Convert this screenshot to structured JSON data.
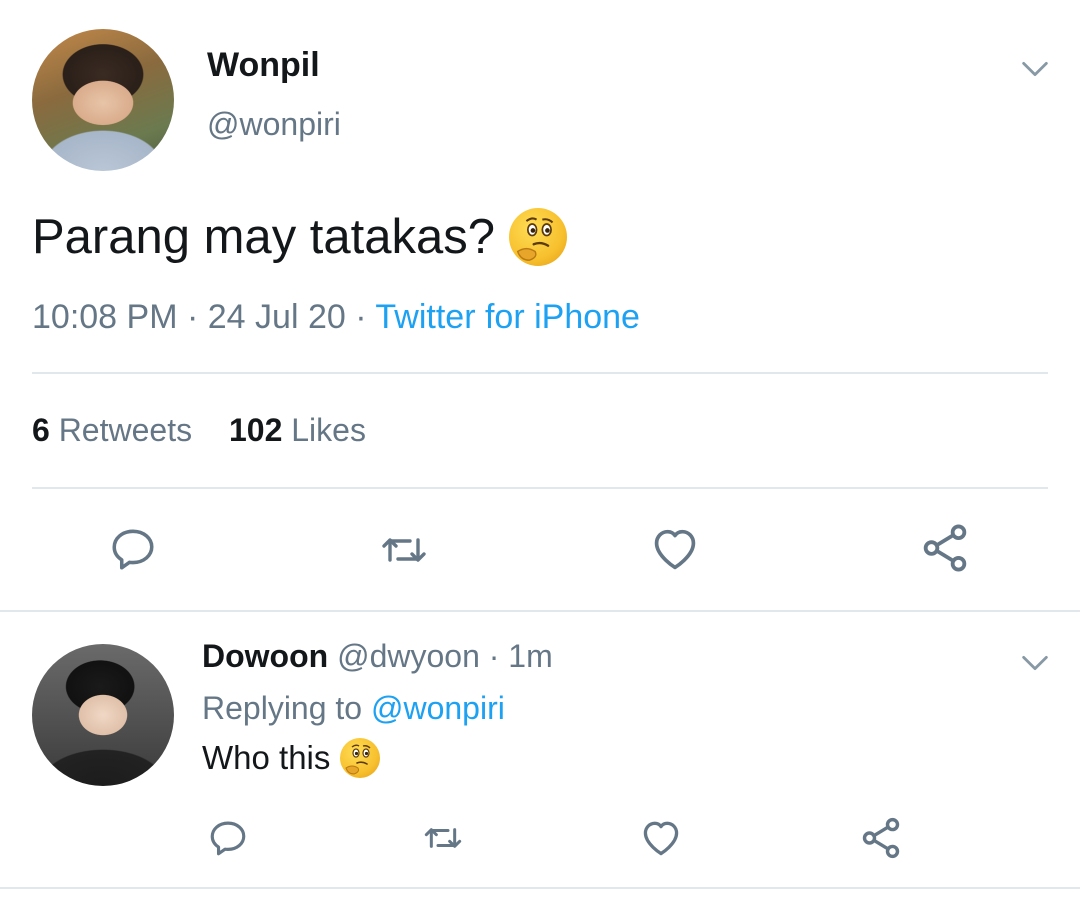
{
  "main_tweet": {
    "author_name": "Wonpil",
    "author_handle": "@wonpiri",
    "text": "Parang may tatakas?",
    "emoji": "thinking-face",
    "time": "10:08 PM",
    "separator": "·",
    "date": "24 Jul 20",
    "source": "Twitter for iPhone",
    "retweets_count": "6",
    "retweets_label": "Retweets",
    "likes_count": "102",
    "likes_label": "Likes"
  },
  "reply_tweet": {
    "author_name": "Dowoon",
    "author_handle": "@dwyoon",
    "separator": "·",
    "age": "1m",
    "replying_prefix": "Replying to",
    "replying_to": "@wonpiri",
    "text": "Who this",
    "emoji": "thinking-face"
  },
  "icons": {
    "reply": "speech-bubble",
    "retweet": "retweet-arrows",
    "like": "heart",
    "share": "share-nodes",
    "menu": "chevron-down"
  },
  "colors": {
    "link_blue": "#1da1f2",
    "secondary_gray": "#657786",
    "divider": "#e1e8ed"
  }
}
